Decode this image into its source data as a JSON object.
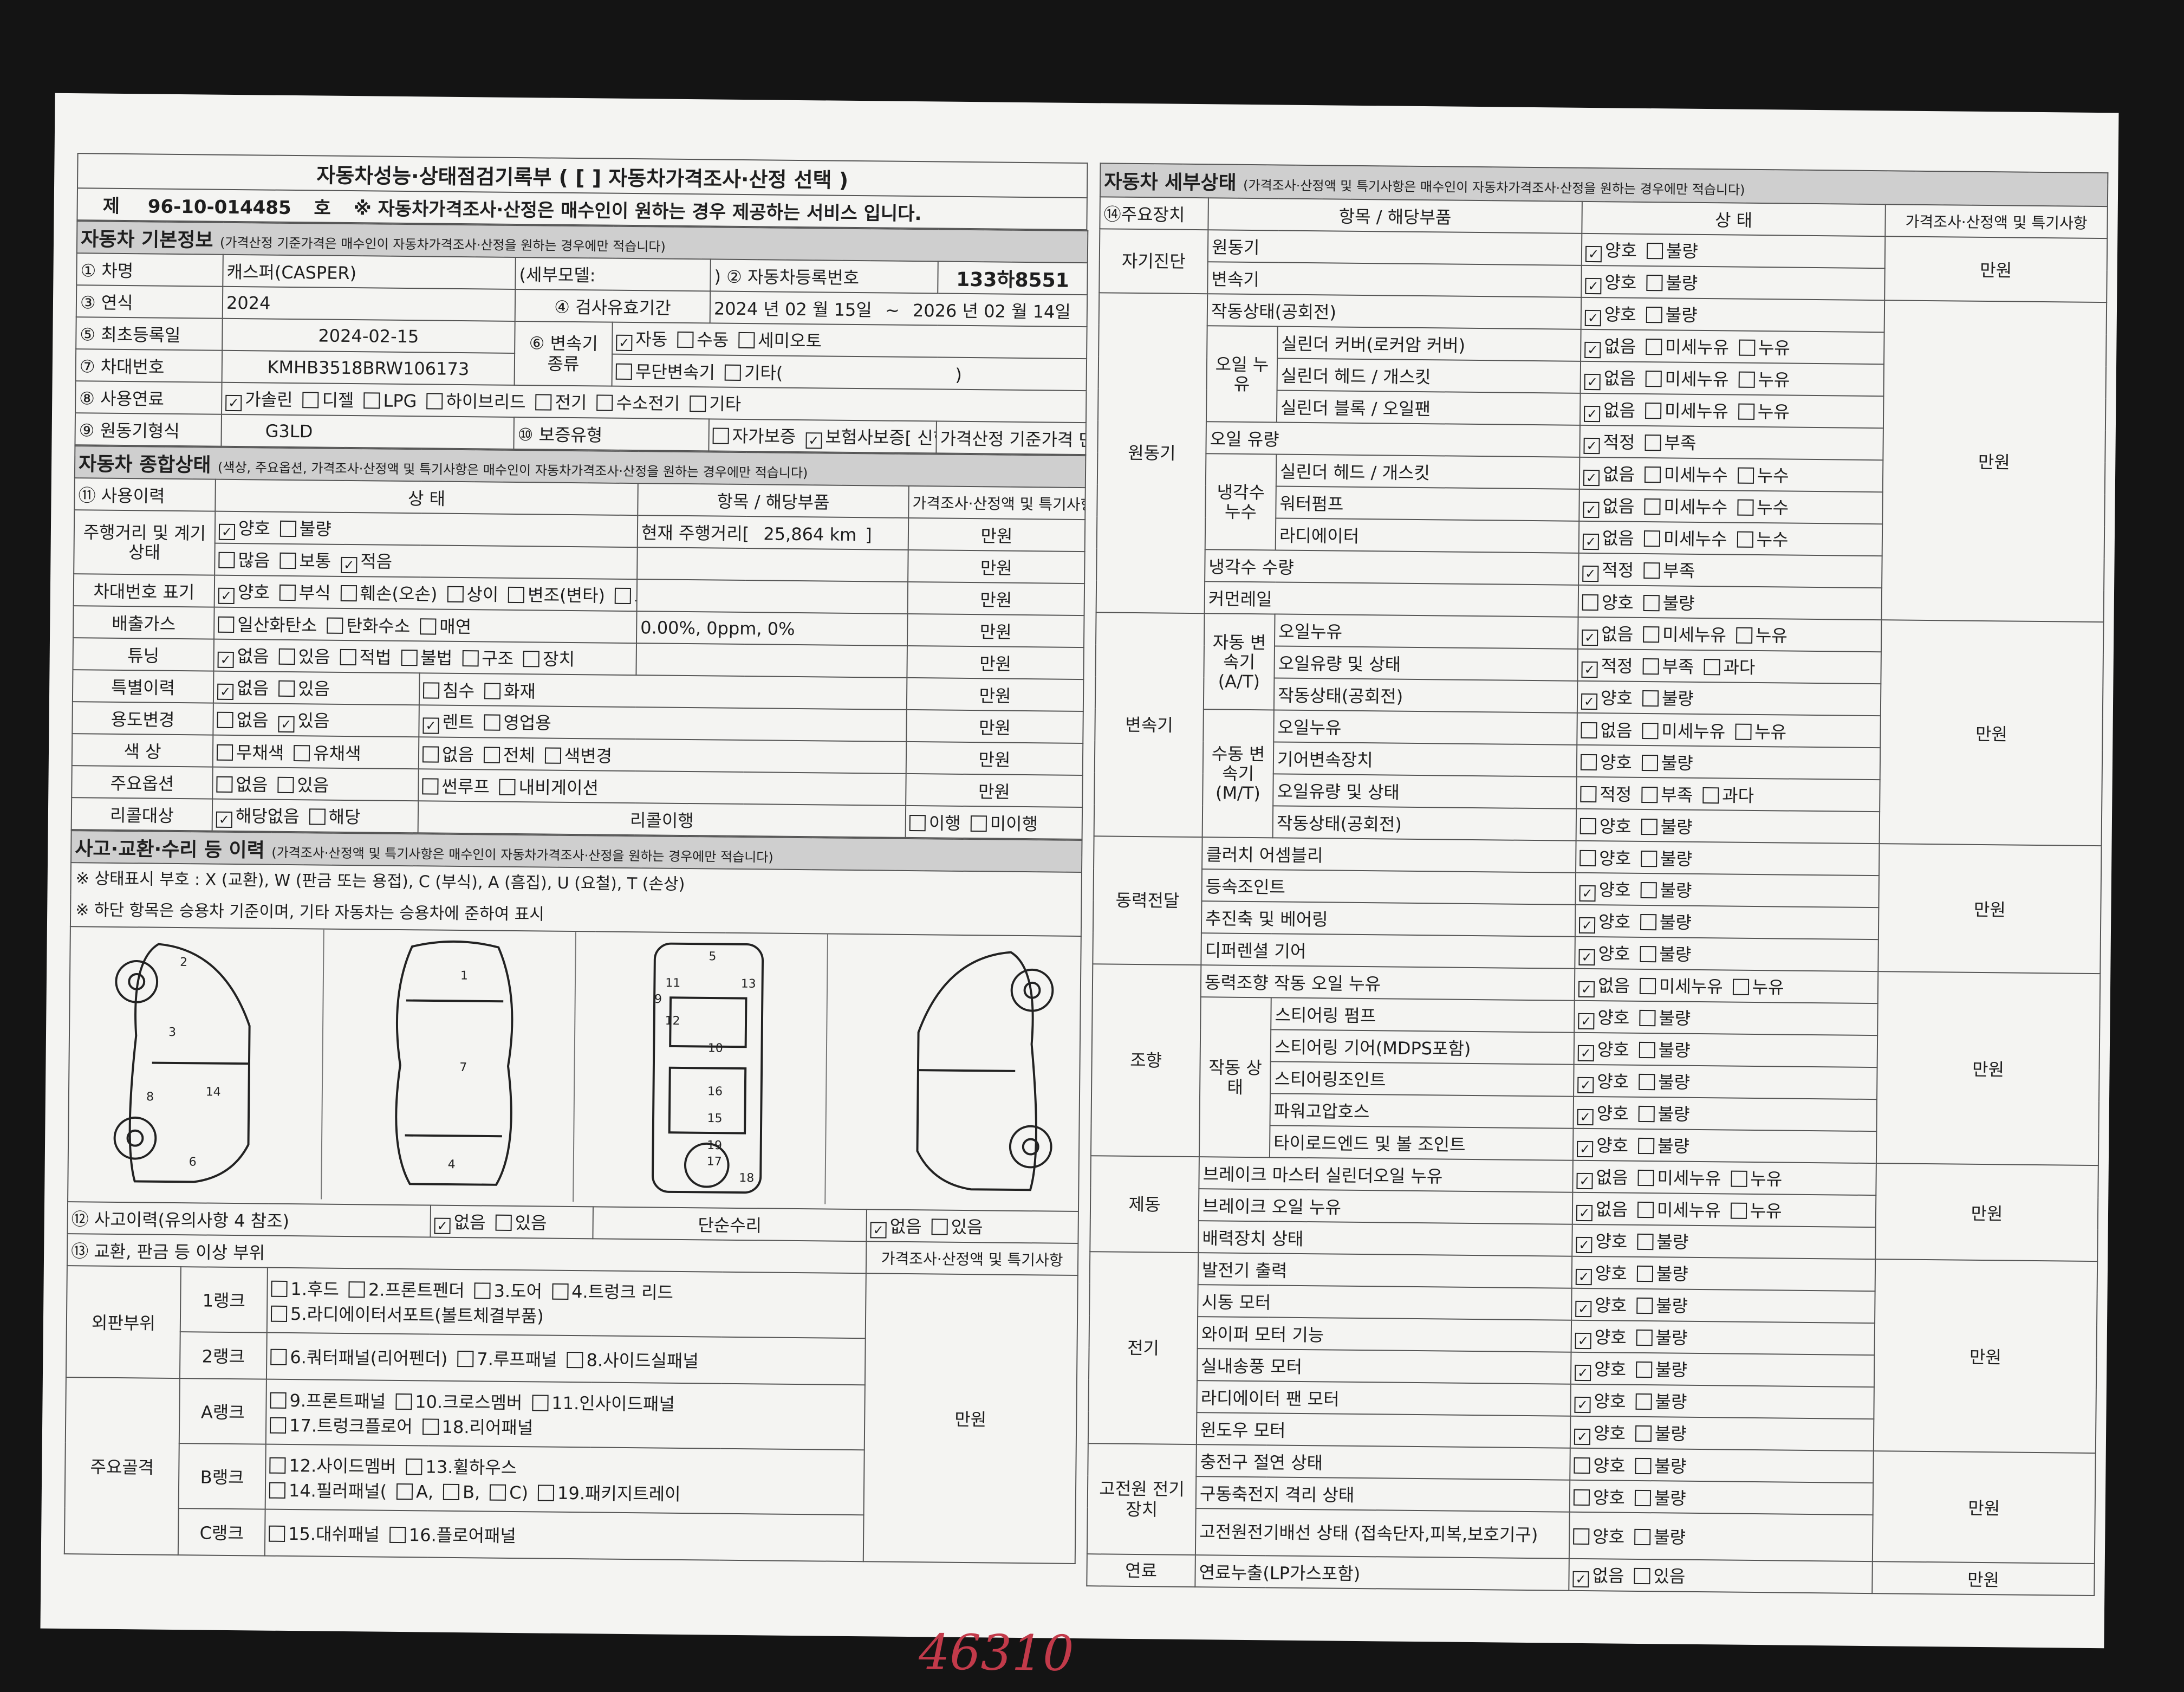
{
  "title": "자동차성능·상태점검기록부 ( [     ] 자동차가격조사·산정 선택 )",
  "doc_no_label": "제",
  "doc_no": "96-10-014485",
  "doc_no_suffix": "호",
  "notice": "※ 자동차가격조사·산정은 매수인이 원하는 경우 제공하는 서비스 입니다.",
  "basic": {
    "header": "자동차 기본정보",
    "header_note": "(가격산정 기준가격은 매수인이 자동차가격조사·산정을 원하는 경우에만 적습니다)",
    "name_label": "① 차명",
    "name": "캐스퍼(CASPER)",
    "detail_model": "(세부모델:",
    "reg_no_label": ") ② 자동차등록번호",
    "reg_no": "133하8551",
    "year_label": "③ 연식",
    "year": "2024",
    "valid_label": "④ 검사유효기간",
    "valid_from": "2024 년 02 월 15일",
    "valid_to": "2026 년 02 월 14일",
    "tilde": "~",
    "first_reg_label": "⑤ 최초등록일",
    "first_reg": "2024-02-15",
    "trans_label": "⑥ 변속기 종류",
    "vin_label": "⑦ 차대번호",
    "vin": "KMHB3518BRW106173",
    "fuel_label": "⑧ 사용연료",
    "engine_label": "⑨ 원동기형식",
    "engine": "G3LD",
    "warranty_label": "⑩ 보증유형",
    "price_label": "가격산정 기준가격",
    "unit": "만원",
    "trans_opts1": [
      {
        "t": "자동",
        "v": "✓"
      },
      {
        "t": "수동",
        "v": ""
      },
      {
        "t": "세미오토",
        "v": ""
      }
    ],
    "trans_opts2": [
      {
        "t": "무단변속기",
        "v": ""
      },
      {
        "t": "기타(",
        "v": ""
      }
    ],
    "close_paren": ")",
    "fuel_opts": [
      {
        "t": "가솔린",
        "v": "✓"
      },
      {
        "t": "디젤",
        "v": ""
      },
      {
        "t": "LPG",
        "v": ""
      },
      {
        "t": "하이브리드",
        "v": ""
      },
      {
        "t": "전기",
        "v": ""
      },
      {
        "t": "수소전기",
        "v": ""
      },
      {
        "t": "기타",
        "v": ""
      }
    ],
    "warranty_opts": [
      {
        "t": "자가보증",
        "v": ""
      },
      {
        "t": "보험사보증[ 신한손보 ]",
        "v": "✓"
      }
    ]
  },
  "overall": {
    "header": "자동차 종합상태",
    "header_note": "(색상, 주요옵션, 가격조사·산정액 및 특기사항은 매수인이 자동차가격조사·산정을 원하는 경우에만 적습니다)",
    "col1": "⑪ 사용이력",
    "col2": "상 태",
    "col3": "항목 / 해당부품",
    "col4": "가격조사·산정액 및 특기사항",
    "mileage_label": "주행거리 및 계기상태",
    "mileage_text": "현재 주행거리[",
    "mileage": "25,864 km",
    "bracket": "]",
    "rows": [
      {
        "label": "",
        "opts": [
          {
            "t": "양호",
            "v": "✓"
          },
          {
            "t": "불량",
            "v": ""
          }
        ],
        "item": ""
      },
      {
        "label": "",
        "opts": [
          {
            "t": "많음",
            "v": ""
          },
          {
            "t": "보통",
            "v": ""
          },
          {
            "t": "적음",
            "v": "✓"
          }
        ],
        "item": ""
      },
      {
        "label": "차대번호 표기",
        "opts": [
          {
            "t": "양호",
            "v": "✓"
          },
          {
            "t": "부식",
            "v": ""
          },
          {
            "t": "훼손(오손)",
            "v": ""
          },
          {
            "t": "상이",
            "v": ""
          },
          {
            "t": "변조(변타)",
            "v": ""
          },
          {
            "t": "도말",
            "v": ""
          }
        ],
        "item": ""
      },
      {
        "label": "배출가스",
        "opts": [
          {
            "t": "일산화탄소",
            "v": ""
          },
          {
            "t": "탄화수소",
            "v": ""
          },
          {
            "t": "매연",
            "v": ""
          }
        ],
        "item": "0.00%,      0ppm,      0%"
      },
      {
        "label": "튜닝",
        "opts": [
          {
            "t": "없음",
            "v": "✓"
          },
          {
            "t": "있음",
            "v": ""
          },
          {
            "t": "적법",
            "v": ""
          },
          {
            "t": "불법",
            "v": ""
          },
          {
            "t": "구조",
            "v": ""
          },
          {
            "t": "장치",
            "v": ""
          }
        ],
        "item": ""
      },
      {
        "label": "특별이력",
        "opts": [
          {
            "t": "없음",
            "v": "✓"
          },
          {
            "t": "있음",
            "v": ""
          }
        ],
        "opts2": [
          {
            "t": "침수",
            "v": ""
          },
          {
            "t": "화재",
            "v": ""
          }
        ],
        "item": ""
      },
      {
        "label": "용도변경",
        "opts": [
          {
            "t": "없음",
            "v": ""
          },
          {
            "t": "있음",
            "v": "✓"
          }
        ],
        "opts2": [
          {
            "t": "렌트",
            "v": "✓"
          },
          {
            "t": "영업용",
            "v": ""
          }
        ],
        "item": ""
      },
      {
        "label": "색    상",
        "opts": [
          {
            "t": "무채색",
            "v": ""
          },
          {
            "t": "유채색",
            "v": ""
          }
        ],
        "opts2": [
          {
            "t": "없음",
            "v": ""
          },
          {
            "t": "전체",
            "v": ""
          },
          {
            "t": "색변경",
            "v": ""
          }
        ],
        "item": ""
      },
      {
        "label": "주요옵션",
        "opts": [
          {
            "t": "없음",
            "v": ""
          },
          {
            "t": "있음",
            "v": ""
          }
        ],
        "opts2": [
          {
            "t": "썬루프",
            "v": ""
          },
          {
            "t": "내비게이션",
            "v": ""
          }
        ],
        "item": ""
      }
    ],
    "recall_label": "리콜대상",
    "recall_opts": [
      {
        "t": "해당없음",
        "v": "✓"
      },
      {
        "t": "해당",
        "v": ""
      }
    ],
    "recall_item": "리콜이행",
    "recall_opts2": [
      {
        "t": "이행",
        "v": ""
      },
      {
        "t": "미이행",
        "v": ""
      }
    ]
  },
  "accident": {
    "header": "사고·교환·수리 등 이력",
    "header_note": "(가격조사·산정액 및 특기사항은 매수인이 자동차가격조사·산정을 원하는 경우에만 적습니다)",
    "note1": "※ 상태표시 부호 : X (교환), W (판금 또는 용접), C (부식), A (흠집), U (요철), T (손상)",
    "note2": "※ 하단 항목은 승용차 기준이며, 기타 자동차는 승용차에 준하여 표시",
    "hist_label": "⑫ 사고이력(유의사항 4 참조)",
    "hist_opts": [
      {
        "t": "없음",
        "v": "✓"
      },
      {
        "t": "있음",
        "v": ""
      }
    ],
    "repair_label": "단순수리",
    "repair_opts": [
      {
        "t": "없음",
        "v": "✓"
      },
      {
        "t": "있음",
        "v": ""
      }
    ],
    "diag_numbers": [
      "1",
      "2",
      "3",
      "4",
      "5",
      "6",
      "7",
      "8",
      "9",
      "10",
      "11",
      "12",
      "13",
      "14",
      "15",
      "16",
      "17",
      "18",
      "19"
    ],
    "parts_label": "⑬ 교환, 판금 등 이상 부위",
    "parts_col": "가격조사·산정액 및 특기사항",
    "outer": "외판부위",
    "frame": "주요골격",
    "rank1": "1랭크",
    "rank1_a": [
      {
        "t": "1.후드",
        "v": ""
      },
      {
        "t": "2.프론트펜더",
        "v": ""
      },
      {
        "t": "3.도어",
        "v": ""
      },
      {
        "t": "4.트렁크 리드",
        "v": ""
      }
    ],
    "rank1_b": [
      {
        "t": "5.라디에이터서포트(볼트체결부품)",
        "v": ""
      }
    ],
    "rank2": "2랭크",
    "rank2_a": [
      {
        "t": "6.쿼터패널(리어펜더)",
        "v": ""
      },
      {
        "t": "7.루프패널",
        "v": ""
      },
      {
        "t": "8.사이드실패널",
        "v": ""
      }
    ],
    "rankA": "A랭크",
    "rankA_a": [
      {
        "t": "9.프론트패널",
        "v": ""
      },
      {
        "t": "10.크로스멤버",
        "v": ""
      },
      {
        "t": "11.인사이드패널",
        "v": ""
      }
    ],
    "rankA_b": [
      {
        "t": "17.트렁크플로어",
        "v": ""
      },
      {
        "t": "18.리어패널",
        "v": ""
      }
    ],
    "rankB": "B랭크",
    "rankB_a": [
      {
        "t": "12.사이드멤버",
        "v": ""
      },
      {
        "t": "13.휠하우스",
        "v": ""
      }
    ],
    "rankB_b": [
      {
        "t": "14.필러패널(",
        "v": ""
      },
      {
        "t": "A,",
        "v": ""
      },
      {
        "t": "B,",
        "v": ""
      },
      {
        "t": "C)",
        "v": ""
      },
      {
        "t": "19.패키지트레이",
        "v": ""
      }
    ],
    "rankC": "C랭크",
    "rankC_a": [
      {
        "t": "15.대쉬패널",
        "v": ""
      },
      {
        "t": "16.플로어패널",
        "v": ""
      }
    ],
    "price": "만원",
    "handwritten": "46310"
  },
  "detail": {
    "header": "자동차 세부상태",
    "header_note": "(가격조사·산정액 및 특기사항은 매수인이 자동차가격조사·산정을 원하는 경우에만 적습니다)",
    "col1": "⑭주요장치",
    "col2": "항목 / 해당부품",
    "col3": "상    태",
    "col4": "가격조사·산정액 및 특기사항",
    "unit": "만원",
    "rows": [
      {
        "g": "자기진단",
        "s": "",
        "i": "원동기",
        "o": [
          {
            "t": "양호",
            "v": "✓"
          },
          {
            "t": "불량",
            "v": ""
          }
        ]
      },
      {
        "g": "",
        "s": "",
        "i": "변속기",
        "o": [
          {
            "t": "양호",
            "v": "✓"
          },
          {
            "t": "불량",
            "v": ""
          }
        ]
      },
      {
        "g": "원동기",
        "s": "",
        "i": "작동상태(공회전)",
        "o": [
          {
            "t": "양호",
            "v": "✓"
          },
          {
            "t": "불량",
            "v": ""
          }
        ]
      },
      {
        "g": "",
        "s": "오일 누유",
        "i": "실린더 커버(로커암 커버)",
        "o": [
          {
            "t": "없음",
            "v": "✓"
          },
          {
            "t": "미세누유",
            "v": ""
          },
          {
            "t": "누유",
            "v": ""
          }
        ]
      },
      {
        "g": "",
        "s": "",
        "i": "실린더 헤드 / 개스킷",
        "o": [
          {
            "t": "없음",
            "v": "✓"
          },
          {
            "t": "미세누유",
            "v": ""
          },
          {
            "t": "누유",
            "v": ""
          }
        ]
      },
      {
        "g": "",
        "s": "",
        "i": "실린더 블록 / 오일팬",
        "o": [
          {
            "t": "없음",
            "v": "✓"
          },
          {
            "t": "미세누유",
            "v": ""
          },
          {
            "t": "누유",
            "v": ""
          }
        ]
      },
      {
        "g": "",
        "s": "",
        "i": "오일 유량",
        "o": [
          {
            "t": "적정",
            "v": "✓"
          },
          {
            "t": "부족",
            "v": ""
          }
        ]
      },
      {
        "g": "",
        "s": "냉각수 누수",
        "i": "실린더 헤드 / 개스킷",
        "o": [
          {
            "t": "없음",
            "v": "✓"
          },
          {
            "t": "미세누수",
            "v": ""
          },
          {
            "t": "누수",
            "v": ""
          }
        ]
      },
      {
        "g": "",
        "s": "",
        "i": "워터펌프",
        "o": [
          {
            "t": "없음",
            "v": "✓"
          },
          {
            "t": "미세누수",
            "v": ""
          },
          {
            "t": "누수",
            "v": ""
          }
        ]
      },
      {
        "g": "",
        "s": "",
        "i": "라디에이터",
        "o": [
          {
            "t": "없음",
            "v": "✓"
          },
          {
            "t": "미세누수",
            "v": ""
          },
          {
            "t": "누수",
            "v": ""
          }
        ]
      },
      {
        "g": "",
        "s": "",
        "i": "냉각수 수량",
        "o": [
          {
            "t": "적정",
            "v": "✓"
          },
          {
            "t": "부족",
            "v": ""
          }
        ]
      },
      {
        "g": "",
        "s": "",
        "i": "커먼레일",
        "o": [
          {
            "t": "양호",
            "v": ""
          },
          {
            "t": "불량",
            "v": ""
          }
        ]
      },
      {
        "g": "변속기",
        "s": "자동 변속기 (A/T)",
        "i": "오일누유",
        "o": [
          {
            "t": "없음",
            "v": "✓"
          },
          {
            "t": "미세누유",
            "v": ""
          },
          {
            "t": "누유",
            "v": ""
          }
        ]
      },
      {
        "g": "",
        "s": "",
        "i": "오일유량 및 상태",
        "o": [
          {
            "t": "적정",
            "v": "✓"
          },
          {
            "t": "부족",
            "v": ""
          },
          {
            "t": "과다",
            "v": ""
          }
        ]
      },
      {
        "g": "",
        "s": "",
        "i": "작동상태(공회전)",
        "o": [
          {
            "t": "양호",
            "v": "✓"
          },
          {
            "t": "불량",
            "v": ""
          }
        ]
      },
      {
        "g": "",
        "s": "수동 변속기 (M/T)",
        "i": "오일누유",
        "o": [
          {
            "t": "없음",
            "v": ""
          },
          {
            "t": "미세누유",
            "v": ""
          },
          {
            "t": "누유",
            "v": ""
          }
        ]
      },
      {
        "g": "",
        "s": "",
        "i": "기어변속장치",
        "o": [
          {
            "t": "양호",
            "v": ""
          },
          {
            "t": "불량",
            "v": ""
          }
        ]
      },
      {
        "g": "",
        "s": "",
        "i": "오일유량 및 상태",
        "o": [
          {
            "t": "적정",
            "v": ""
          },
          {
            "t": "부족",
            "v": ""
          },
          {
            "t": "과다",
            "v": ""
          }
        ]
      },
      {
        "g": "",
        "s": "",
        "i": "작동상태(공회전)",
        "o": [
          {
            "t": "양호",
            "v": ""
          },
          {
            "t": "불량",
            "v": ""
          }
        ]
      },
      {
        "g": "동력전달",
        "s": "",
        "i": "클러치 어셈블리",
        "o": [
          {
            "t": "양호",
            "v": ""
          },
          {
            "t": "불량",
            "v": ""
          }
        ]
      },
      {
        "g": "",
        "s": "",
        "i": "등속조인트",
        "o": [
          {
            "t": "양호",
            "v": "✓"
          },
          {
            "t": "불량",
            "v": ""
          }
        ]
      },
      {
        "g": "",
        "s": "",
        "i": "추진축 및 베어링",
        "o": [
          {
            "t": "양호",
            "v": "✓"
          },
          {
            "t": "불량",
            "v": ""
          }
        ]
      },
      {
        "g": "",
        "s": "",
        "i": "디퍼렌셜 기어",
        "o": [
          {
            "t": "양호",
            "v": "✓"
          },
          {
            "t": "불량",
            "v": ""
          }
        ]
      },
      {
        "g": "조향",
        "s": "",
        "i": "동력조향 작동 오일 누유",
        "o": [
          {
            "t": "없음",
            "v": "✓"
          },
          {
            "t": "미세누유",
            "v": ""
          },
          {
            "t": "누유",
            "v": ""
          }
        ]
      },
      {
        "g": "",
        "s": "작동 상태",
        "i": "스티어링 펌프",
        "o": [
          {
            "t": "양호",
            "v": "✓"
          },
          {
            "t": "불량",
            "v": ""
          }
        ]
      },
      {
        "g": "",
        "s": "",
        "i": "스티어링 기어(MDPS포함)",
        "o": [
          {
            "t": "양호",
            "v": "✓"
          },
          {
            "t": "불량",
            "v": ""
          }
        ]
      },
      {
        "g": "",
        "s": "",
        "i": "스티어링조인트",
        "o": [
          {
            "t": "양호",
            "v": "✓"
          },
          {
            "t": "불량",
            "v": ""
          }
        ]
      },
      {
        "g": "",
        "s": "",
        "i": "파워고압호스",
        "o": [
          {
            "t": "양호",
            "v": "✓"
          },
          {
            "t": "불량",
            "v": ""
          }
        ]
      },
      {
        "g": "",
        "s": "",
        "i": "타이로드엔드 및 볼 조인트",
        "o": [
          {
            "t": "양호",
            "v": "✓"
          },
          {
            "t": "불량",
            "v": ""
          }
        ]
      },
      {
        "g": "제동",
        "s": "",
        "i": "브레이크 마스터 실린더오일 누유",
        "o": [
          {
            "t": "없음",
            "v": "✓"
          },
          {
            "t": "미세누유",
            "v": ""
          },
          {
            "t": "누유",
            "v": ""
          }
        ]
      },
      {
        "g": "",
        "s": "",
        "i": "브레이크 오일 누유",
        "o": [
          {
            "t": "없음",
            "v": "✓"
          },
          {
            "t": "미세누유",
            "v": ""
          },
          {
            "t": "누유",
            "v": ""
          }
        ]
      },
      {
        "g": "",
        "s": "",
        "i": "배력장치 상태",
        "o": [
          {
            "t": "양호",
            "v": "✓"
          },
          {
            "t": "불량",
            "v": ""
          }
        ]
      },
      {
        "g": "전기",
        "s": "",
        "i": "발전기 출력",
        "o": [
          {
            "t": "양호",
            "v": "✓"
          },
          {
            "t": "불량",
            "v": ""
          }
        ]
      },
      {
        "g": "",
        "s": "",
        "i": "시동 모터",
        "o": [
          {
            "t": "양호",
            "v": "✓"
          },
          {
            "t": "불량",
            "v": ""
          }
        ]
      },
      {
        "g": "",
        "s": "",
        "i": "와이퍼 모터 기능",
        "o": [
          {
            "t": "양호",
            "v": "✓"
          },
          {
            "t": "불량",
            "v": ""
          }
        ]
      },
      {
        "g": "",
        "s": "",
        "i": "실내송풍 모터",
        "o": [
          {
            "t": "양호",
            "v": "✓"
          },
          {
            "t": "불량",
            "v": ""
          }
        ]
      },
      {
        "g": "",
        "s": "",
        "i": "라디에이터 팬 모터",
        "o": [
          {
            "t": "양호",
            "v": "✓"
          },
          {
            "t": "불량",
            "v": ""
          }
        ]
      },
      {
        "g": "",
        "s": "",
        "i": "윈도우 모터",
        "o": [
          {
            "t": "양호",
            "v": "✓"
          },
          {
            "t": "불량",
            "v": ""
          }
        ]
      },
      {
        "g": "고전원 전기장치",
        "s": "",
        "i": "충전구 절연 상태",
        "o": [
          {
            "t": "양호",
            "v": ""
          },
          {
            "t": "불량",
            "v": ""
          }
        ]
      },
      {
        "g": "",
        "s": "",
        "i": "구동축전지 격리 상태",
        "o": [
          {
            "t": "양호",
            "v": ""
          },
          {
            "t": "불량",
            "v": ""
          }
        ]
      },
      {
        "g": "",
        "s": "",
        "i": "고전원전기배선 상태 (접속단자,피복,보호기구)",
        "o": [
          {
            "t": "양호",
            "v": ""
          },
          {
            "t": "불량",
            "v": ""
          }
        ]
      },
      {
        "g": "연료",
        "s": "",
        "i": "연료누출(LP가스포함)",
        "o": [
          {
            "t": "없음",
            "v": "✓"
          },
          {
            "t": "있음",
            "v": ""
          }
        ]
      }
    ]
  }
}
